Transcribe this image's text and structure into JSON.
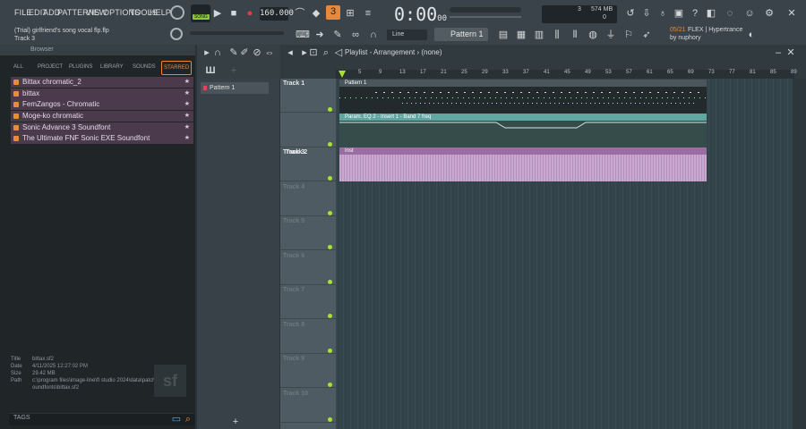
{
  "menu": [
    "FILE",
    "EDIT",
    "ADD",
    "PATTERNS",
    "VIEW",
    "OPTIONS",
    "TOOLS",
    "HELP"
  ],
  "transport": {
    "mode": "SONG",
    "bpm": "160.000",
    "time_main": "0:00",
    "time_sub": "00"
  },
  "stats": {
    "cpu": "3",
    "mem": "574 MB",
    "poly": "0"
  },
  "project": {
    "title": "(Trial) girlfriend's song vocal flp.flp",
    "track": "Track 3"
  },
  "news": {
    "date": "05/21",
    "text": "FLEX | Hypertrance",
    "by": "by nuphory"
  },
  "toolbar": {
    "snap": "Line",
    "pattern": "Pattern 1"
  },
  "browser": {
    "title": "Browser",
    "tabs": [
      "ALL",
      "PROJECT",
      "PLUGINS",
      "LIBRARY",
      "SOUNDS",
      "STARRED"
    ],
    "items": [
      "Bittax chromatic_2",
      "bittax",
      "FemZangos - Chromatic",
      "Moge-ko chromatic",
      "Sonic Advance 3 Soundfont",
      "The Ultimate FNF Sonic EXE Soundfont"
    ],
    "info": {
      "title_k": "Title",
      "title_v": "bittax.sf2",
      "date_k": "Date",
      "date_v": "4/11/2025 12:27:02 PM",
      "size_k": "Size",
      "size_v": "29.42 MB",
      "path_k": "Path",
      "path_v": "c:\\program files\\image-line\\fl studio 2024\\data\\patches\\soundfonts\\bittax.sf2"
    },
    "tags": "TAGS"
  },
  "patterns": {
    "item": "Pattern 1"
  },
  "playlist": {
    "title": "Playlist - Arrangement",
    "sub": "(none)",
    "ruler": [
      "5",
      "9",
      "13",
      "17",
      "21",
      "25",
      "29",
      "33",
      "37",
      "41",
      "45",
      "49",
      "53",
      "57",
      "61",
      "65",
      "69",
      "73",
      "77",
      "81",
      "85",
      "89"
    ],
    "tracks": [
      "Track 1",
      "Track 2",
      "Track 3",
      "Track 4",
      "Track 5",
      "Track 6",
      "Track 7",
      "Track 8",
      "Track 9",
      "Track 10"
    ],
    "clips": {
      "c1": "Pattern 1",
      "c2": "Param. EQ 2 - Insert 1 - Band 7 freq",
      "c3": "Inst"
    }
  },
  "colors": {
    "accent": "#e8883a",
    "led": "#a6e22e",
    "audio": "#c9a9cf",
    "auto": "#5fa7a0"
  }
}
